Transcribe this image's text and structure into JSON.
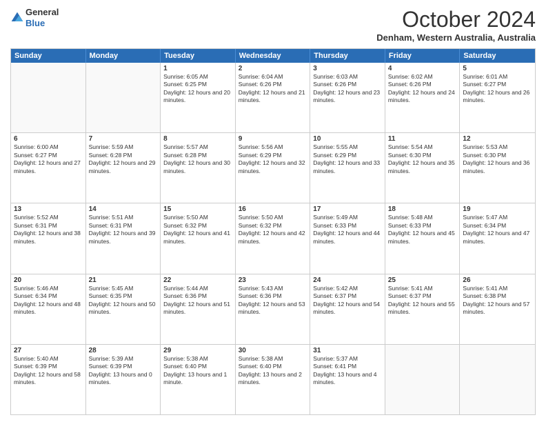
{
  "header": {
    "logo_general": "General",
    "logo_blue": "Blue",
    "month_title": "October 2024",
    "subtitle": "Denham, Western Australia, Australia"
  },
  "calendar": {
    "days_of_week": [
      "Sunday",
      "Monday",
      "Tuesday",
      "Wednesday",
      "Thursday",
      "Friday",
      "Saturday"
    ],
    "weeks": [
      [
        {
          "day": "",
          "empty": true
        },
        {
          "day": "",
          "empty": true
        },
        {
          "day": "1",
          "sunrise": "6:05 AM",
          "sunset": "6:25 PM",
          "daylight": "12 hours and 20 minutes."
        },
        {
          "day": "2",
          "sunrise": "6:04 AM",
          "sunset": "6:26 PM",
          "daylight": "12 hours and 21 minutes."
        },
        {
          "day": "3",
          "sunrise": "6:03 AM",
          "sunset": "6:26 PM",
          "daylight": "12 hours and 23 minutes."
        },
        {
          "day": "4",
          "sunrise": "6:02 AM",
          "sunset": "6:26 PM",
          "daylight": "12 hours and 24 minutes."
        },
        {
          "day": "5",
          "sunrise": "6:01 AM",
          "sunset": "6:27 PM",
          "daylight": "12 hours and 26 minutes."
        }
      ],
      [
        {
          "day": "6",
          "sunrise": "6:00 AM",
          "sunset": "6:27 PM",
          "daylight": "12 hours and 27 minutes."
        },
        {
          "day": "7",
          "sunrise": "5:59 AM",
          "sunset": "6:28 PM",
          "daylight": "12 hours and 29 minutes."
        },
        {
          "day": "8",
          "sunrise": "5:57 AM",
          "sunset": "6:28 PM",
          "daylight": "12 hours and 30 minutes."
        },
        {
          "day": "9",
          "sunrise": "5:56 AM",
          "sunset": "6:29 PM",
          "daylight": "12 hours and 32 minutes."
        },
        {
          "day": "10",
          "sunrise": "5:55 AM",
          "sunset": "6:29 PM",
          "daylight": "12 hours and 33 minutes."
        },
        {
          "day": "11",
          "sunrise": "5:54 AM",
          "sunset": "6:30 PM",
          "daylight": "12 hours and 35 minutes."
        },
        {
          "day": "12",
          "sunrise": "5:53 AM",
          "sunset": "6:30 PM",
          "daylight": "12 hours and 36 minutes."
        }
      ],
      [
        {
          "day": "13",
          "sunrise": "5:52 AM",
          "sunset": "6:31 PM",
          "daylight": "12 hours and 38 minutes."
        },
        {
          "day": "14",
          "sunrise": "5:51 AM",
          "sunset": "6:31 PM",
          "daylight": "12 hours and 39 minutes."
        },
        {
          "day": "15",
          "sunrise": "5:50 AM",
          "sunset": "6:32 PM",
          "daylight": "12 hours and 41 minutes."
        },
        {
          "day": "16",
          "sunrise": "5:50 AM",
          "sunset": "6:32 PM",
          "daylight": "12 hours and 42 minutes."
        },
        {
          "day": "17",
          "sunrise": "5:49 AM",
          "sunset": "6:33 PM",
          "daylight": "12 hours and 44 minutes."
        },
        {
          "day": "18",
          "sunrise": "5:48 AM",
          "sunset": "6:33 PM",
          "daylight": "12 hours and 45 minutes."
        },
        {
          "day": "19",
          "sunrise": "5:47 AM",
          "sunset": "6:34 PM",
          "daylight": "12 hours and 47 minutes."
        }
      ],
      [
        {
          "day": "20",
          "sunrise": "5:46 AM",
          "sunset": "6:34 PM",
          "daylight": "12 hours and 48 minutes."
        },
        {
          "day": "21",
          "sunrise": "5:45 AM",
          "sunset": "6:35 PM",
          "daylight": "12 hours and 50 minutes."
        },
        {
          "day": "22",
          "sunrise": "5:44 AM",
          "sunset": "6:36 PM",
          "daylight": "12 hours and 51 minutes."
        },
        {
          "day": "23",
          "sunrise": "5:43 AM",
          "sunset": "6:36 PM",
          "daylight": "12 hours and 53 minutes."
        },
        {
          "day": "24",
          "sunrise": "5:42 AM",
          "sunset": "6:37 PM",
          "daylight": "12 hours and 54 minutes."
        },
        {
          "day": "25",
          "sunrise": "5:41 AM",
          "sunset": "6:37 PM",
          "daylight": "12 hours and 55 minutes."
        },
        {
          "day": "26",
          "sunrise": "5:41 AM",
          "sunset": "6:38 PM",
          "daylight": "12 hours and 57 minutes."
        }
      ],
      [
        {
          "day": "27",
          "sunrise": "5:40 AM",
          "sunset": "6:39 PM",
          "daylight": "12 hours and 58 minutes."
        },
        {
          "day": "28",
          "sunrise": "5:39 AM",
          "sunset": "6:39 PM",
          "daylight": "13 hours and 0 minutes."
        },
        {
          "day": "29",
          "sunrise": "5:38 AM",
          "sunset": "6:40 PM",
          "daylight": "13 hours and 1 minute."
        },
        {
          "day": "30",
          "sunrise": "5:38 AM",
          "sunset": "6:40 PM",
          "daylight": "13 hours and 2 minutes."
        },
        {
          "day": "31",
          "sunrise": "5:37 AM",
          "sunset": "6:41 PM",
          "daylight": "13 hours and 4 minutes."
        },
        {
          "day": "",
          "empty": true
        },
        {
          "day": "",
          "empty": true
        }
      ]
    ]
  }
}
